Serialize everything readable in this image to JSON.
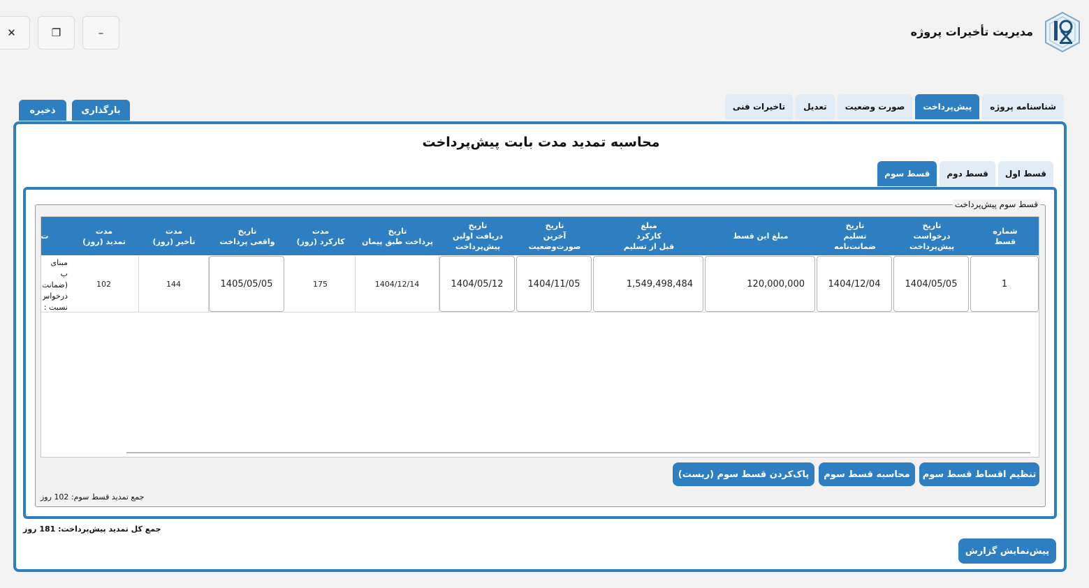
{
  "window": {
    "title": "مدیریت تأخیرات پروژه",
    "close_glyph": "✕",
    "restore_glyph": "❐",
    "minimize_glyph": "–"
  },
  "top_tabs": [
    {
      "label": "شناسنامه پروژه",
      "active": false
    },
    {
      "label": "پیش‌پرداخت",
      "active": true
    },
    {
      "label": "صورت وضعیت",
      "active": false
    },
    {
      "label": "تعدیل",
      "active": false
    },
    {
      "label": "تاخیرات فنی",
      "active": false
    }
  ],
  "actions": {
    "load_label": "بارگذاری",
    "save_label": "ذخیره"
  },
  "main": {
    "title": "محاسبه تمدید مدت بابت پیش‌پرداخت",
    "sub_tabs": [
      {
        "label": "قسط اول",
        "active": false
      },
      {
        "label": "قسط دوم",
        "active": false
      },
      {
        "label": "قسط سوم",
        "active": true
      }
    ],
    "group_title": "قسط سوم پیش‌پرداخت",
    "table": {
      "headers": [
        "شماره\nقسط",
        "تاریخ\nدرخواست\nپیش‌پرداخت",
        "تاریخ\nتسلیم\nضمانت‌نامه",
        "مبلغ این قسط",
        "مبلغ\nکارکرد\nقبل از تسلیم",
        "تاریخ\nآخرین\nصورت‌وضعیت",
        "تاریخ\nدریافت اولین\nپیش‌پرداخت",
        "تاریخ\nپرداخت طبق پیمان",
        "مدت\nکارکرد (روز)",
        "تاریخ\nواقعی پرداخت",
        "مدت\nتأخیر (روز)",
        "مدت\nتمدید (روز)",
        "ت"
      ],
      "row": {
        "installment_no": "1",
        "request_date": "1404/05/05",
        "guarantee_date": "1404/12/04",
        "amount": "120,000,000",
        "work_amount": "1,549,498,484",
        "last_statement_date": "1404/11/05",
        "first_receipt_date": "1404/05/12",
        "contract_payment_date": "1404/12/14",
        "work_days": "175",
        "actual_payment_date": "1405/05/05",
        "delay_days": "144",
        "extension_days": "102",
        "note_partial": "مبنای ب\n(ضمانت\nدرخواس\nنسبت :\nپرداخت"
      }
    },
    "buttons": {
      "set_installments": "تنظیم اقساط قسط سوم",
      "calculate": "محاسبه قسط سوم",
      "reset": "پاک‌کردن قسط سوم (ریست)"
    },
    "third_sum_text": "جمع تمدید قسط سوم: 102 روز",
    "total_sum_text": "جمع کل تمدید پیش‌پرداخت: 181 روز",
    "preview_label": "پیش‌نمایش گزارش"
  },
  "colors": {
    "accent": "#2e7fc1",
    "tab_inactive": "#e2ecf6",
    "background": "#f3f3f3"
  }
}
